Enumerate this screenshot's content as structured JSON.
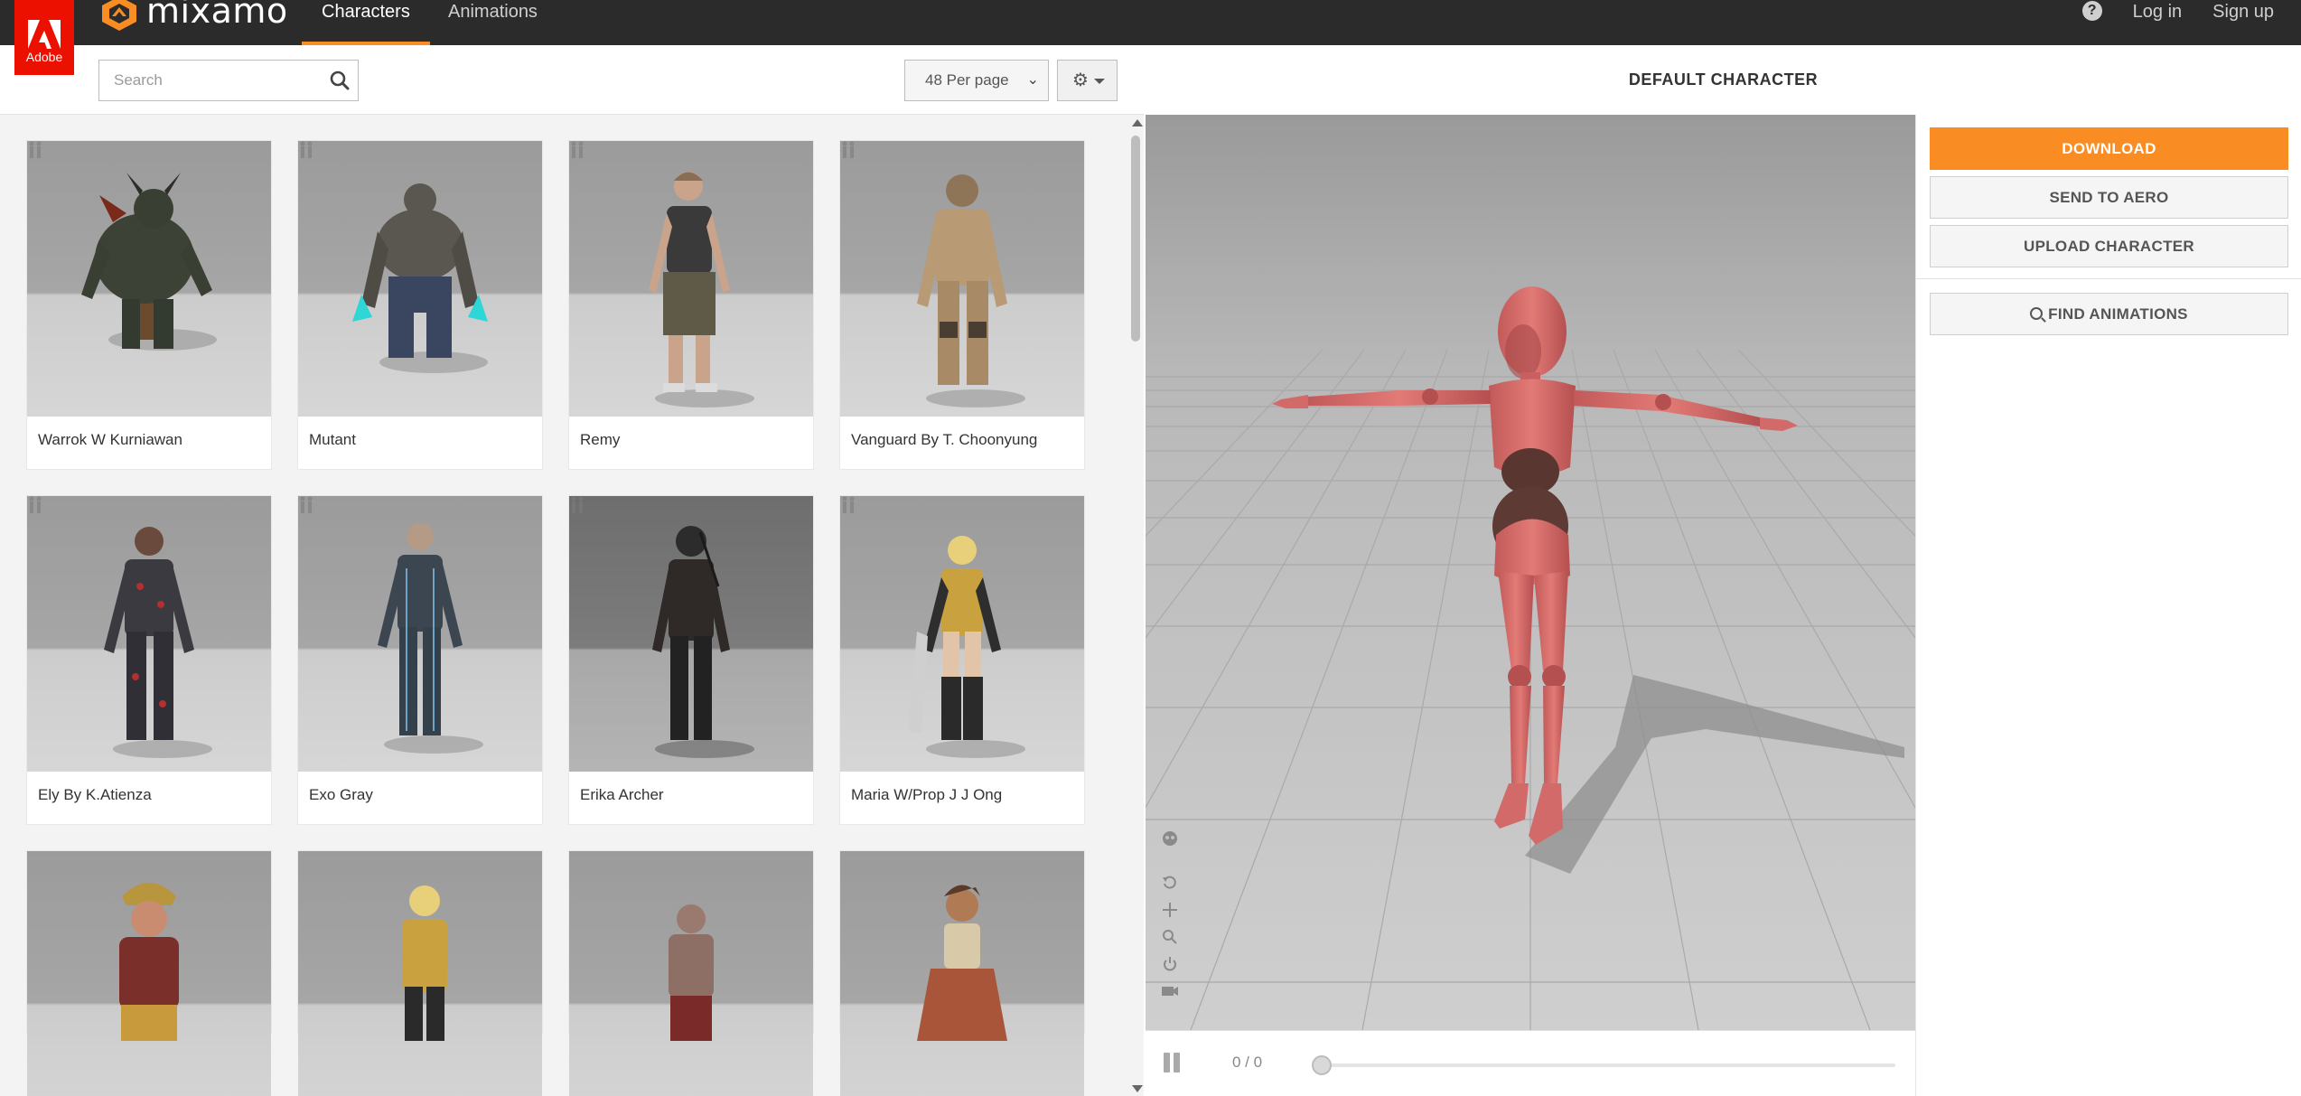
{
  "brand": {
    "adobe": "Adobe",
    "name": "mixamo",
    "accent": "#f98c22",
    "adobe_red": "#eb1000"
  },
  "nav": {
    "tabs": [
      {
        "label": "Characters",
        "active": true
      },
      {
        "label": "Animations",
        "active": false
      }
    ],
    "right": {
      "help_icon": "?",
      "login": "Log in",
      "signup": "Sign up"
    }
  },
  "toolbar": {
    "search_placeholder": "Search",
    "per_page": "48 Per page",
    "per_page_caret": "⌄",
    "settings_icon": "⚙"
  },
  "characters": [
    {
      "name": "Warrok W Kurniawan"
    },
    {
      "name": "Mutant"
    },
    {
      "name": "Remy"
    },
    {
      "name": "Vanguard By T. Choonyung"
    },
    {
      "name": "Ely By K.Atienza"
    },
    {
      "name": "Exo Gray"
    },
    {
      "name": "Erika Archer"
    },
    {
      "name": "Maria W/Prop J J Ong"
    },
    {
      "name": ""
    },
    {
      "name": ""
    },
    {
      "name": ""
    },
    {
      "name": ""
    }
  ],
  "viewer": {
    "title": "DEFAULT CHARACTER",
    "frame_counter": "0 / 0",
    "timeline_progress": 0
  },
  "actions": {
    "download": "DOWNLOAD",
    "send_to_aero": "SEND TO AERO",
    "upload_character": "UPLOAD CHARACTER",
    "find_animations": "FIND ANIMATIONS"
  }
}
